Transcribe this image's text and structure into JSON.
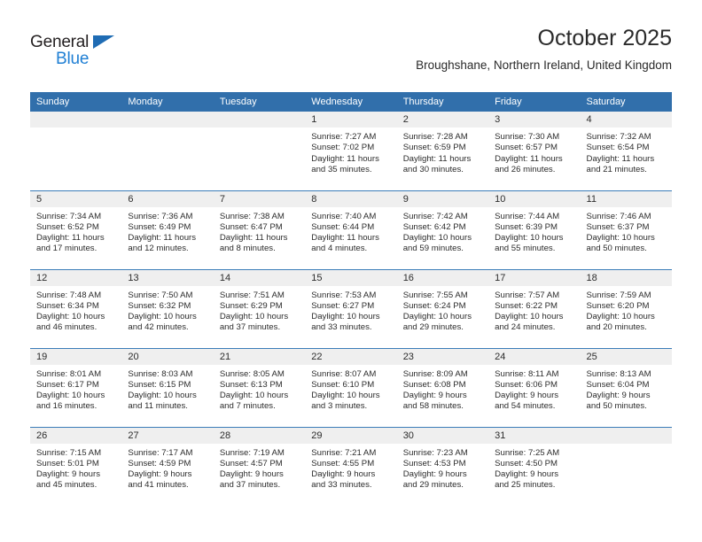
{
  "brand": {
    "name_top": "General",
    "name_bottom": "Blue",
    "triangle_color": "#1f6cb4",
    "blue_text_color": "#1f7fd4"
  },
  "header": {
    "title": "October 2025",
    "location": "Broughshane, Northern Ireland, United Kingdom"
  },
  "theme": {
    "header_bg": "#316fab",
    "row_divider": "#3b7cb8",
    "daynum_band_bg": "#efefef",
    "text": "#2c2c2c"
  },
  "calendar": {
    "weekday_headers": [
      "Sunday",
      "Monday",
      "Tuesday",
      "Wednesday",
      "Thursday",
      "Friday",
      "Saturday"
    ],
    "weeks": [
      [
        {
          "empty": true
        },
        {
          "empty": true
        },
        {
          "empty": true
        },
        {
          "day": "1",
          "sunrise": "Sunrise: 7:27 AM",
          "sunset": "Sunset: 7:02 PM",
          "daylight_1": "Daylight: 11 hours",
          "daylight_2": "and 35 minutes."
        },
        {
          "day": "2",
          "sunrise": "Sunrise: 7:28 AM",
          "sunset": "Sunset: 6:59 PM",
          "daylight_1": "Daylight: 11 hours",
          "daylight_2": "and 30 minutes."
        },
        {
          "day": "3",
          "sunrise": "Sunrise: 7:30 AM",
          "sunset": "Sunset: 6:57 PM",
          "daylight_1": "Daylight: 11 hours",
          "daylight_2": "and 26 minutes."
        },
        {
          "day": "4",
          "sunrise": "Sunrise: 7:32 AM",
          "sunset": "Sunset: 6:54 PM",
          "daylight_1": "Daylight: 11 hours",
          "daylight_2": "and 21 minutes."
        }
      ],
      [
        {
          "day": "5",
          "sunrise": "Sunrise: 7:34 AM",
          "sunset": "Sunset: 6:52 PM",
          "daylight_1": "Daylight: 11 hours",
          "daylight_2": "and 17 minutes."
        },
        {
          "day": "6",
          "sunrise": "Sunrise: 7:36 AM",
          "sunset": "Sunset: 6:49 PM",
          "daylight_1": "Daylight: 11 hours",
          "daylight_2": "and 12 minutes."
        },
        {
          "day": "7",
          "sunrise": "Sunrise: 7:38 AM",
          "sunset": "Sunset: 6:47 PM",
          "daylight_1": "Daylight: 11 hours",
          "daylight_2": "and 8 minutes."
        },
        {
          "day": "8",
          "sunrise": "Sunrise: 7:40 AM",
          "sunset": "Sunset: 6:44 PM",
          "daylight_1": "Daylight: 11 hours",
          "daylight_2": "and 4 minutes."
        },
        {
          "day": "9",
          "sunrise": "Sunrise: 7:42 AM",
          "sunset": "Sunset: 6:42 PM",
          "daylight_1": "Daylight: 10 hours",
          "daylight_2": "and 59 minutes."
        },
        {
          "day": "10",
          "sunrise": "Sunrise: 7:44 AM",
          "sunset": "Sunset: 6:39 PM",
          "daylight_1": "Daylight: 10 hours",
          "daylight_2": "and 55 minutes."
        },
        {
          "day": "11",
          "sunrise": "Sunrise: 7:46 AM",
          "sunset": "Sunset: 6:37 PM",
          "daylight_1": "Daylight: 10 hours",
          "daylight_2": "and 50 minutes."
        }
      ],
      [
        {
          "day": "12",
          "sunrise": "Sunrise: 7:48 AM",
          "sunset": "Sunset: 6:34 PM",
          "daylight_1": "Daylight: 10 hours",
          "daylight_2": "and 46 minutes."
        },
        {
          "day": "13",
          "sunrise": "Sunrise: 7:50 AM",
          "sunset": "Sunset: 6:32 PM",
          "daylight_1": "Daylight: 10 hours",
          "daylight_2": "and 42 minutes."
        },
        {
          "day": "14",
          "sunrise": "Sunrise: 7:51 AM",
          "sunset": "Sunset: 6:29 PM",
          "daylight_1": "Daylight: 10 hours",
          "daylight_2": "and 37 minutes."
        },
        {
          "day": "15",
          "sunrise": "Sunrise: 7:53 AM",
          "sunset": "Sunset: 6:27 PM",
          "daylight_1": "Daylight: 10 hours",
          "daylight_2": "and 33 minutes."
        },
        {
          "day": "16",
          "sunrise": "Sunrise: 7:55 AM",
          "sunset": "Sunset: 6:24 PM",
          "daylight_1": "Daylight: 10 hours",
          "daylight_2": "and 29 minutes."
        },
        {
          "day": "17",
          "sunrise": "Sunrise: 7:57 AM",
          "sunset": "Sunset: 6:22 PM",
          "daylight_1": "Daylight: 10 hours",
          "daylight_2": "and 24 minutes."
        },
        {
          "day": "18",
          "sunrise": "Sunrise: 7:59 AM",
          "sunset": "Sunset: 6:20 PM",
          "daylight_1": "Daylight: 10 hours",
          "daylight_2": "and 20 minutes."
        }
      ],
      [
        {
          "day": "19",
          "sunrise": "Sunrise: 8:01 AM",
          "sunset": "Sunset: 6:17 PM",
          "daylight_1": "Daylight: 10 hours",
          "daylight_2": "and 16 minutes."
        },
        {
          "day": "20",
          "sunrise": "Sunrise: 8:03 AM",
          "sunset": "Sunset: 6:15 PM",
          "daylight_1": "Daylight: 10 hours",
          "daylight_2": "and 11 minutes."
        },
        {
          "day": "21",
          "sunrise": "Sunrise: 8:05 AM",
          "sunset": "Sunset: 6:13 PM",
          "daylight_1": "Daylight: 10 hours",
          "daylight_2": "and 7 minutes."
        },
        {
          "day": "22",
          "sunrise": "Sunrise: 8:07 AM",
          "sunset": "Sunset: 6:10 PM",
          "daylight_1": "Daylight: 10 hours",
          "daylight_2": "and 3 minutes."
        },
        {
          "day": "23",
          "sunrise": "Sunrise: 8:09 AM",
          "sunset": "Sunset: 6:08 PM",
          "daylight_1": "Daylight: 9 hours",
          "daylight_2": "and 58 minutes."
        },
        {
          "day": "24",
          "sunrise": "Sunrise: 8:11 AM",
          "sunset": "Sunset: 6:06 PM",
          "daylight_1": "Daylight: 9 hours",
          "daylight_2": "and 54 minutes."
        },
        {
          "day": "25",
          "sunrise": "Sunrise: 8:13 AM",
          "sunset": "Sunset: 6:04 PM",
          "daylight_1": "Daylight: 9 hours",
          "daylight_2": "and 50 minutes."
        }
      ],
      [
        {
          "day": "26",
          "sunrise": "Sunrise: 7:15 AM",
          "sunset": "Sunset: 5:01 PM",
          "daylight_1": "Daylight: 9 hours",
          "daylight_2": "and 45 minutes."
        },
        {
          "day": "27",
          "sunrise": "Sunrise: 7:17 AM",
          "sunset": "Sunset: 4:59 PM",
          "daylight_1": "Daylight: 9 hours",
          "daylight_2": "and 41 minutes."
        },
        {
          "day": "28",
          "sunrise": "Sunrise: 7:19 AM",
          "sunset": "Sunset: 4:57 PM",
          "daylight_1": "Daylight: 9 hours",
          "daylight_2": "and 37 minutes."
        },
        {
          "day": "29",
          "sunrise": "Sunrise: 7:21 AM",
          "sunset": "Sunset: 4:55 PM",
          "daylight_1": "Daylight: 9 hours",
          "daylight_2": "and 33 minutes."
        },
        {
          "day": "30",
          "sunrise": "Sunrise: 7:23 AM",
          "sunset": "Sunset: 4:53 PM",
          "daylight_1": "Daylight: 9 hours",
          "daylight_2": "and 29 minutes."
        },
        {
          "day": "31",
          "sunrise": "Sunrise: 7:25 AM",
          "sunset": "Sunset: 4:50 PM",
          "daylight_1": "Daylight: 9 hours",
          "daylight_2": "and 25 minutes."
        },
        {
          "empty": true
        }
      ]
    ]
  }
}
